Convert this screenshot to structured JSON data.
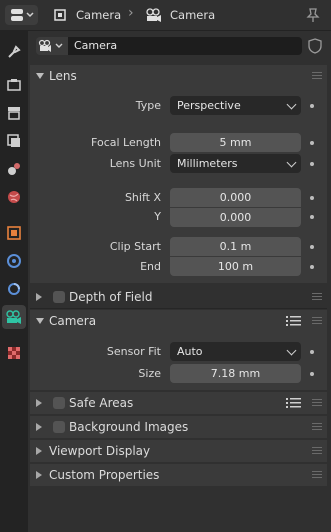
{
  "header": {
    "object_label": "Camera",
    "data_label": "Camera"
  },
  "datablock": {
    "name": "Camera"
  },
  "tabs": [
    "tool-icon",
    "render-icon",
    "output-icon",
    "view-layer-icon",
    "scene-icon",
    "world-icon",
    "object-icon",
    "modifiers-icon",
    "physics-icon",
    "object-data-camera-icon",
    "texture-icon"
  ],
  "lens": {
    "title": "Lens",
    "type_label": "Type",
    "type_value": "Perspective",
    "focal_label": "Focal Length",
    "focal_value": "5 mm",
    "unit_label": "Lens Unit",
    "unit_value": "Millimeters",
    "shiftx_label": "Shift X",
    "shiftx_value": "0.000",
    "shifty_label": "Y",
    "shifty_value": "0.000",
    "clipstart_label": "Clip Start",
    "clipstart_value": "0.1 m",
    "clipend_label": "End",
    "clipend_value": "100 m"
  },
  "dof": {
    "title": "Depth of Field"
  },
  "camera": {
    "title": "Camera",
    "fit_label": "Sensor Fit",
    "fit_value": "Auto",
    "size_label": "Size",
    "size_value": "7.18 mm"
  },
  "panels": {
    "safe_areas": "Safe Areas",
    "background_images": "Background Images",
    "viewport_display": "Viewport Display",
    "custom_properties": "Custom Properties"
  },
  "colors": {
    "background": "#303030",
    "panel": "#3a3a3a",
    "field": "#545454",
    "dropdown": "#282828",
    "active_tab_icon": "#2fc4a4"
  }
}
